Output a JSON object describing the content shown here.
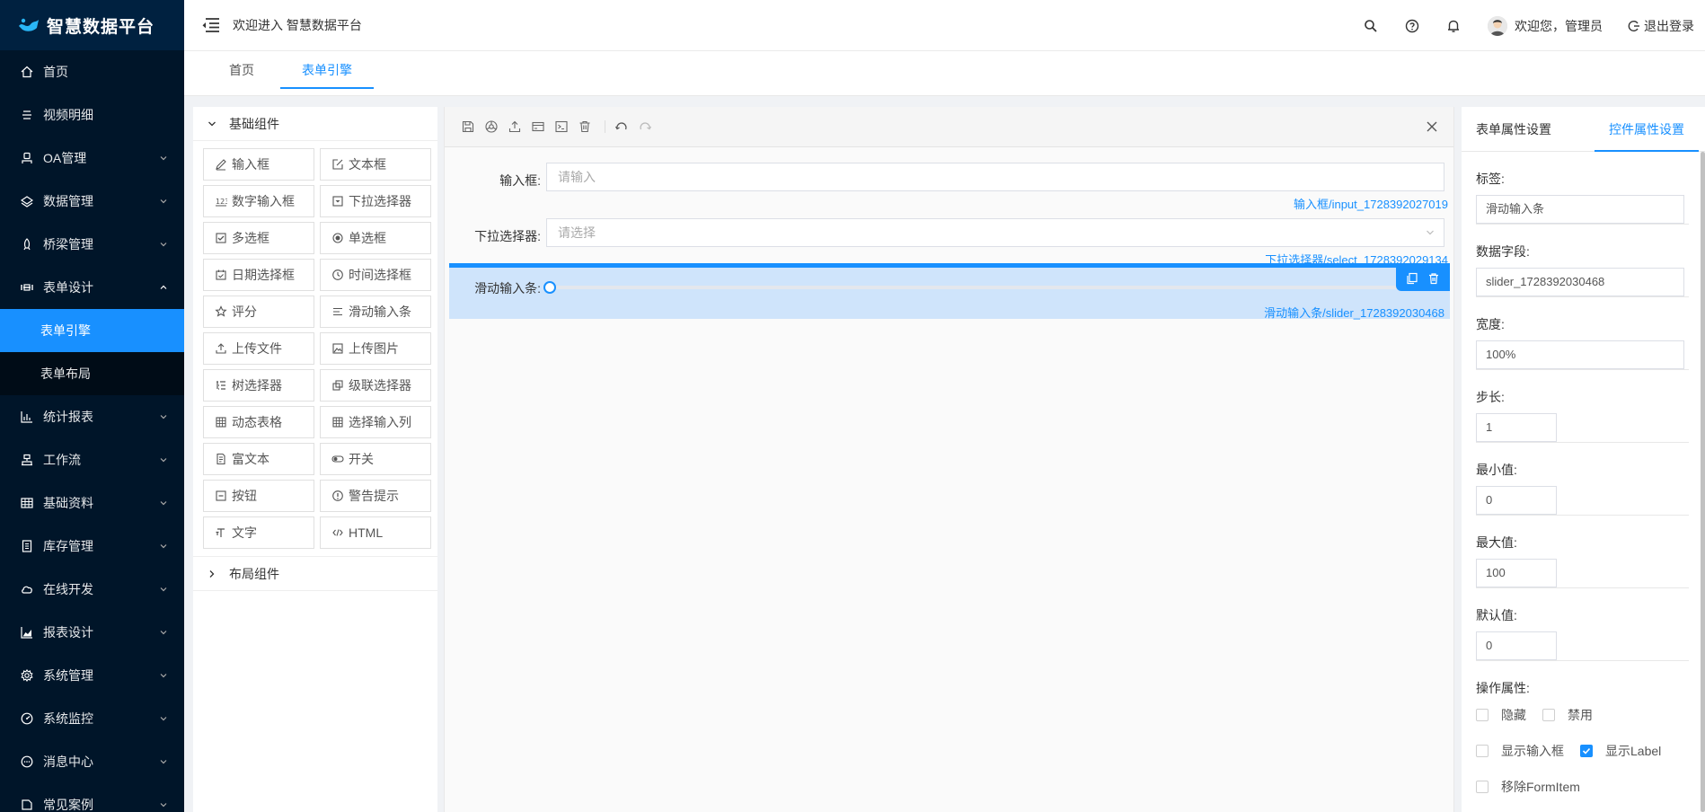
{
  "brand": {
    "title": "智慧数据平台"
  },
  "sidebar": {
    "items": [
      {
        "label": "首页",
        "icon": "home-icon",
        "has_arrow": false
      },
      {
        "label": "视频明细",
        "icon": "list-icon",
        "has_arrow": false
      },
      {
        "label": "OA管理",
        "icon": "user-icon",
        "has_arrow": true
      },
      {
        "label": "数据管理",
        "icon": "database-icon",
        "has_arrow": true
      },
      {
        "label": "桥梁管理",
        "icon": "rocket-icon",
        "has_arrow": true
      },
      {
        "label": "表单设计",
        "icon": "form-design-icon",
        "has_arrow": true,
        "expanded": true
      }
    ],
    "submenu": [
      {
        "label": "表单引擎",
        "active": true
      },
      {
        "label": "表单布局",
        "active": false
      }
    ],
    "items_after": [
      {
        "label": "统计报表",
        "icon": "bar-chart-icon"
      },
      {
        "label": "工作流",
        "icon": "workflow-icon"
      },
      {
        "label": "基础资料",
        "icon": "table-icon"
      },
      {
        "label": "库存管理",
        "icon": "inventory-icon"
      },
      {
        "label": "在线开发",
        "icon": "cloud-icon"
      },
      {
        "label": "报表设计",
        "icon": "area-chart-icon"
      },
      {
        "label": "系统管理",
        "icon": "gear-icon"
      },
      {
        "label": "系统监控",
        "icon": "dashboard-icon"
      },
      {
        "label": "消息中心",
        "icon": "message-icon"
      },
      {
        "label": "常见案例",
        "icon": "case-icon"
      }
    ]
  },
  "header": {
    "welcome": "欢迎进入 智慧数据平台",
    "user_greeting": "欢迎您，管理员",
    "logout": "退出登录"
  },
  "tabs": [
    {
      "label": "首页",
      "active": false
    },
    {
      "label": "表单引擎",
      "active": true
    }
  ],
  "components": {
    "basic_group": "基础组件",
    "layout_group": "布局组件",
    "items": [
      {
        "label": "输入框",
        "icon": "edit-icon"
      },
      {
        "label": "文本框",
        "icon": "edit-square-icon"
      },
      {
        "label": "数字输入框",
        "icon": "number-icon"
      },
      {
        "label": "下拉选择器",
        "icon": "dropdown-icon"
      },
      {
        "label": "多选框",
        "icon": "checkbox-icon"
      },
      {
        "label": "单选框",
        "icon": "radio-icon"
      },
      {
        "label": "日期选择框",
        "icon": "calendar-icon"
      },
      {
        "label": "时间选择框",
        "icon": "clock-icon"
      },
      {
        "label": "评分",
        "icon": "star-icon"
      },
      {
        "label": "滑动输入条",
        "icon": "slider-icon"
      },
      {
        "label": "上传文件",
        "icon": "upload-icon"
      },
      {
        "label": "上传图片",
        "icon": "image-icon"
      },
      {
        "label": "树选择器",
        "icon": "tree-icon"
      },
      {
        "label": "级联选择器",
        "icon": "cascader-icon"
      },
      {
        "label": "动态表格",
        "icon": "grid-icon"
      },
      {
        "label": "选择输入列",
        "icon": "grid-icon"
      },
      {
        "label": "富文本",
        "icon": "richtext-icon"
      },
      {
        "label": "开关",
        "icon": "switch-icon"
      },
      {
        "label": "按钮",
        "icon": "button-icon"
      },
      {
        "label": "警告提示",
        "icon": "alert-icon"
      },
      {
        "label": "文字",
        "icon": "text-icon"
      },
      {
        "label": "HTML",
        "icon": "code-icon"
      }
    ]
  },
  "canvas": {
    "fields": [
      {
        "label": "输入框:",
        "placeholder": "请输入",
        "caption": "输入框/input_1728392027019",
        "kind": "input"
      },
      {
        "label": "下拉选择器:",
        "placeholder": "请选择",
        "caption": "下拉选择器/select_1728392029134",
        "kind": "select"
      }
    ],
    "slider": {
      "label": "滑动输入条:",
      "caption": "滑动输入条/slider_1728392030468",
      "value": 0
    }
  },
  "props": {
    "tab_form": "表单属性设置",
    "tab_control": "控件属性设置",
    "fields": [
      {
        "label": "标签:",
        "value": "滑动输入条",
        "short": false
      },
      {
        "label": "数据字段:",
        "value": "slider_1728392030468",
        "short": false
      },
      {
        "label": "宽度:",
        "value": "100%",
        "short": false
      },
      {
        "label": "步长:",
        "value": "1",
        "short": true
      },
      {
        "label": "最小值:",
        "value": "0",
        "short": true
      },
      {
        "label": "最大值:",
        "value": "100",
        "short": true
      },
      {
        "label": "默认值:",
        "value": "0",
        "short": true
      }
    ],
    "ops_label": "操作属性:",
    "options": {
      "hidden": {
        "label": "隐藏",
        "checked": false
      },
      "disabled": {
        "label": "禁用",
        "checked": false
      },
      "show_input": {
        "label": "显示输入框",
        "checked": false
      },
      "show_label": {
        "label": "显示Label",
        "checked": true
      },
      "remove_formitem": {
        "label": "移除FormItem",
        "checked": false
      }
    }
  },
  "colors": {
    "accent": "#1890ff",
    "sidebar_bg": "#001529",
    "selected_bg": "#cfe4fb"
  }
}
